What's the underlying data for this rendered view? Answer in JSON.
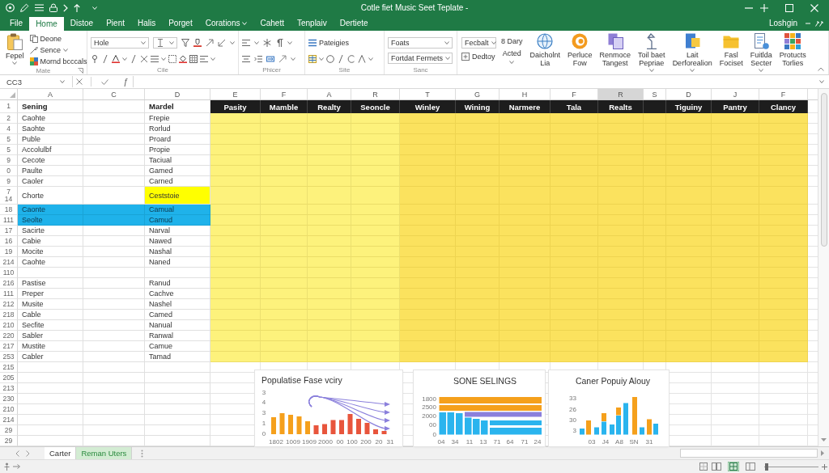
{
  "window": {
    "title": "Cotle fiet Music Seet Teplate -"
  },
  "menu": {
    "tabs": [
      {
        "label": "File",
        "selected": false,
        "menu": false
      },
      {
        "label": "Home",
        "selected": true,
        "menu": false
      },
      {
        "label": "Distoe",
        "selected": false,
        "menu": false
      },
      {
        "label": "Pient",
        "selected": false,
        "menu": false
      },
      {
        "label": "Halis",
        "selected": false,
        "menu": false
      },
      {
        "label": "Porget",
        "selected": false,
        "menu": false
      },
      {
        "label": "Corations",
        "selected": false,
        "menu": true
      },
      {
        "label": "Cahett",
        "selected": false,
        "menu": false
      },
      {
        "label": "Tenplaiv",
        "selected": false,
        "menu": false
      },
      {
        "label": "Dertiete",
        "selected": false,
        "menu": false
      }
    ],
    "account": "Loshgin"
  },
  "ribbon": {
    "groups": [
      {
        "kind": "clipboard",
        "label": "Mate",
        "paste": {
          "label": "Fepel",
          "menu": true
        },
        "items": [
          {
            "label": "Deone",
            "menu": false
          },
          {
            "label": "Sence",
            "menu": true
          },
          {
            "label": "Mornd bcccals",
            "menu": false
          }
        ]
      },
      {
        "kind": "font",
        "label": "Cile",
        "font": "Hole"
      },
      {
        "kind": "alignment",
        "label": "Phicer"
      },
      {
        "kind": "styles",
        "label": "Site",
        "button": "Pateigies"
      },
      {
        "kind": "number",
        "label": "Sanc",
        "dropdowns": [
          "Foats",
          "Fortdat Fermets"
        ]
      },
      {
        "kind": "commands",
        "dropdown": "Fecbalt",
        "button": "Dedtoy",
        "stack": [
          {
            "label": "8 Dary",
            "menu": false
          },
          {
            "label": "Acted",
            "menu": true
          }
        ],
        "large": [
          {
            "label": "Daicholnt\nLia",
            "menu": false
          },
          {
            "label": "Perluce\nFow",
            "menu": false
          },
          {
            "label": "Renmoce\nTangest",
            "menu": false
          },
          {
            "label": "Toil baet\nPepriae",
            "menu": true
          },
          {
            "label": "Lait\nDerforealion",
            "menu": true
          },
          {
            "label": "Fasl\nFociset",
            "menu": false
          },
          {
            "label": "Fuitlda\nSecter",
            "menu": true
          },
          {
            "label": "Protucts\nTorlies",
            "menu": false
          }
        ]
      }
    ]
  },
  "formula_bar": {
    "name_box": "CC3",
    "function_symbol": "ƒ"
  },
  "sheet": {
    "columns": [
      {
        "letter": "A",
        "title": "Sening",
        "selected": false
      },
      {
        "letter": "C",
        "selected": false
      },
      {
        "letter": "D",
        "title": "Mardel",
        "selected": false
      }
    ],
    "range_columns": [
      {
        "letter": "E",
        "title": "Pasity",
        "selected": false
      },
      {
        "letter": "F",
        "title": "Mamble",
        "selected": false
      },
      {
        "letter": "A",
        "title": "Realty",
        "selected": false
      },
      {
        "letter": "R",
        "title": "Seoncle",
        "selected": false
      },
      {
        "letter": "T",
        "title": "Winley",
        "selected": false
      },
      {
        "letter": "G",
        "title": "Wining",
        "selected": false
      },
      {
        "letter": "H",
        "title": "Narmere",
        "selected": false
      },
      {
        "letter": "F",
        "title": "Tala",
        "selected": false
      },
      {
        "letter": "R",
        "title": "Realts",
        "selected": true
      },
      {
        "letter": "S",
        "selected": false
      },
      {
        "letter": "D",
        "title": "Tiguiny",
        "selected": false
      },
      {
        "letter": "J",
        "title": "Pantry",
        "selected": false
      },
      {
        "letter": "F",
        "title": "Clancy",
        "selected": false
      }
    ],
    "header_row": "1",
    "rows": [
      {
        "number": "2",
        "a": "Caohte",
        "d": "Frepie",
        "selected": false,
        "filled": true,
        "highlighted": false
      },
      {
        "number": "4",
        "a": "Saohte",
        "d": "Rorlud",
        "selected": false,
        "filled": true,
        "highlighted": false
      },
      {
        "number": "5",
        "a": "Puble",
        "d": "Proard",
        "selected": false,
        "filled": true,
        "highlighted": false
      },
      {
        "number": "5",
        "a": "Accolulbf",
        "d": "Propie",
        "selected": false,
        "filled": true,
        "highlighted": false
      },
      {
        "number": "9",
        "a": "Cecote",
        "d": "Taciual",
        "selected": false,
        "filled": true,
        "highlighted": false
      },
      {
        "number": "0",
        "a": "Paulte",
        "d": "Gamed",
        "selected": false,
        "filled": true,
        "highlighted": false
      },
      {
        "number": "9",
        "a": "Caoler",
        "d": "Carned",
        "selected": false,
        "filled": true,
        "highlighted": false
      },
      {
        "number": "7\n14",
        "a": "Chorte",
        "d": "Ceststoie",
        "selected": false,
        "filled": true,
        "highlighted": true
      },
      {
        "number": "18",
        "a": "Caonte",
        "d": "Camual",
        "selected": true,
        "filled": true,
        "highlighted": false
      },
      {
        "number": "111",
        "a": "Seolte",
        "d": "Camud",
        "selected": true,
        "filled": true,
        "highlighted": false
      },
      {
        "number": "17",
        "a": "Sacirte",
        "d": "Narval",
        "selected": false,
        "filled": true,
        "highlighted": false
      },
      {
        "number": "16",
        "a": "Cabie",
        "d": "Nawed",
        "selected": false,
        "filled": true,
        "highlighted": false
      },
      {
        "number": "19",
        "a": "Mocite",
        "d": "Nashal",
        "selected": false,
        "filled": true,
        "highlighted": false
      },
      {
        "number": "214",
        "a": "Caohte",
        "d": "Naned",
        "selected": false,
        "filled": true,
        "highlighted": false
      },
      {
        "number": "110",
        "selected": false,
        "filled": true,
        "highlighted": false
      },
      {
        "number": "216",
        "a": "Pastise",
        "d": "Ranud",
        "selected": false,
        "filled": true,
        "highlighted": false
      },
      {
        "number": "111",
        "a": "Preper",
        "d": "Cachve",
        "selected": false,
        "filled": true,
        "highlighted": false
      },
      {
        "number": "212",
        "a": "Musite",
        "d": "Nashel",
        "selected": false,
        "filled": true,
        "highlighted": false
      },
      {
        "number": "218",
        "a": "Cable",
        "d": "Camed",
        "selected": false,
        "filled": true,
        "highlighted": false
      },
      {
        "number": "210",
        "a": "Secfite",
        "d": "Nanual",
        "selected": false,
        "filled": true,
        "highlighted": false
      },
      {
        "number": "220",
        "a": "Sabler",
        "d": "Ranwal",
        "selected": false,
        "filled": true,
        "highlighted": false
      },
      {
        "number": "217",
        "a": "Mustite",
        "d": "Camue",
        "selected": false,
        "filled": true,
        "highlighted": false
      },
      {
        "number": "253",
        "a": "Cabler",
        "d": "Tamad",
        "selected": false,
        "filled": true,
        "highlighted": false
      },
      {
        "number": "215",
        "selected": false,
        "filled": false,
        "highlighted": false
      },
      {
        "number": "205",
        "selected": false,
        "filled": false,
        "highlighted": false
      },
      {
        "number": "213",
        "selected": false,
        "filled": false,
        "highlighted": false
      },
      {
        "number": "230",
        "selected": false,
        "filled": false,
        "highlighted": false
      },
      {
        "number": "210",
        "selected": false,
        "filled": false,
        "highlighted": false
      },
      {
        "number": "214",
        "selected": false,
        "filled": false,
        "highlighted": false
      },
      {
        "number": "29",
        "selected": false,
        "filled": false,
        "highlighted": false
      },
      {
        "number": "29",
        "selected": false,
        "filled": false,
        "highlighted": false
      }
    ],
    "charts": [
      {
        "kind": "bars-with-arrows",
        "title": "Populatise Fase vciry",
        "y_labels": [
          "3",
          "4",
          "3",
          "1",
          "0"
        ],
        "x_labels": [
          "1802",
          "1009",
          "1909",
          "2000",
          "00",
          "100",
          "200",
          "20",
          "31"
        ]
      },
      {
        "kind": "banded-bars",
        "title": "SONE SELINGS",
        "y_labels": [
          "1800",
          "2500",
          "2000",
          "00",
          "0"
        ],
        "x_labels": [
          "04",
          "34",
          "11",
          "13",
          "71",
          "64",
          "71",
          "24"
        ]
      },
      {
        "kind": "grouped-bars",
        "title": "Caner Popuiy Alouy",
        "y_labels": [
          "33",
          "26",
          "30",
          "3"
        ],
        "x_labels": [
          "03",
          "J4",
          "A8",
          "SN",
          "31"
        ]
      }
    ]
  },
  "sheet_tabs": {
    "tabs": [
      {
        "label": "Carter",
        "selected": false
      },
      {
        "label": "Reman Uters",
        "selected": true
      }
    ]
  },
  "status_bar": {
    "views": [
      {
        "selected": false
      },
      {
        "selected": false
      },
      {
        "selected": true
      },
      {
        "selected": false
      }
    ],
    "zoom": {
      "level": 0.05
    }
  }
}
